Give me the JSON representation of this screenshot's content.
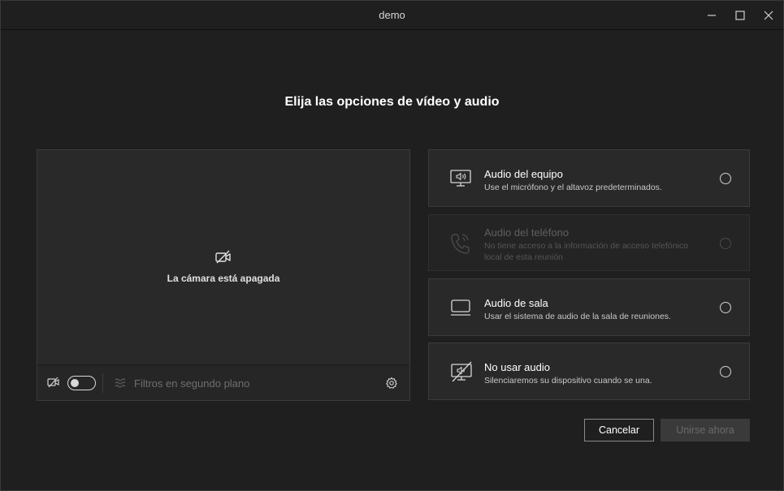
{
  "window": {
    "title": "demo"
  },
  "heading": "Elija las opciones de vídeo y audio",
  "video": {
    "camera_off_text": "La cámara está apagada",
    "camera_toggle_on": false,
    "filters_label": "Filtros en segundo plano"
  },
  "audio_options": [
    {
      "title": "Audio del equipo",
      "description": "Use el micrófono y el altavoz predeterminados.",
      "icon": "computer-speaker-icon",
      "enabled": true,
      "selected": false
    },
    {
      "title": "Audio del teléfono",
      "description": "No tiene acceso a la información de acceso telefónico local de esta reunión",
      "icon": "phone-icon",
      "enabled": false,
      "selected": false
    },
    {
      "title": "Audio de sala",
      "description": "Usar el sistema de audio de la sala de reuniones.",
      "icon": "room-display-icon",
      "enabled": true,
      "selected": false
    },
    {
      "title": "No usar audio",
      "description": "Silenciaremos su dispositivo cuando se una.",
      "icon": "no-audio-icon",
      "enabled": true,
      "selected": false
    }
  ],
  "buttons": {
    "cancel": "Cancelar",
    "join": "Unirse ahora"
  },
  "colors": {
    "background": "#1f1f1f",
    "panel": "#292929",
    "text": "#ffffff",
    "disabled_text": "#5f5f5f"
  }
}
